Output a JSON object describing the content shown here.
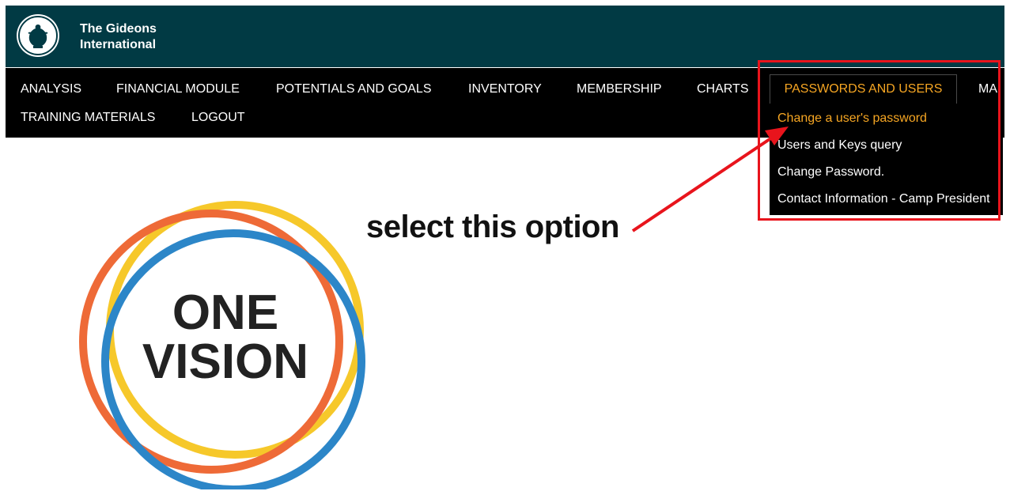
{
  "header": {
    "brand_line1": "The Gideons",
    "brand_line2": "International",
    "logo_icon": "lamp-logo-icon",
    "background": "#013a44"
  },
  "nav": {
    "items": [
      {
        "label": "ANALYSIS"
      },
      {
        "label": "FINANCIAL MODULE"
      },
      {
        "label": "POTENTIALS AND GOALS"
      },
      {
        "label": "INVENTORY"
      },
      {
        "label": "MEMBERSHIP"
      },
      {
        "label": "CHARTS"
      },
      {
        "label": "PASSWORDS AND USERS",
        "active": true
      },
      {
        "label": "MAI"
      },
      {
        "label": "TRAINING MATERIALS"
      },
      {
        "label": "LOGOUT"
      }
    ],
    "accent_color": "#f6a623"
  },
  "dropdown": {
    "items": [
      {
        "label": "Change a user's password",
        "highlighted": true
      },
      {
        "label": "Users and Keys query"
      },
      {
        "label": "Change Password."
      },
      {
        "label": "Contact Information - Camp President"
      }
    ]
  },
  "annotation": {
    "text": "select this option",
    "color": "#e8141c"
  },
  "hero": {
    "line1": "ONE",
    "line2": "VISION",
    "ring_colors": [
      "#f6c82a",
      "#ee6a37",
      "#2c86c8"
    ]
  }
}
